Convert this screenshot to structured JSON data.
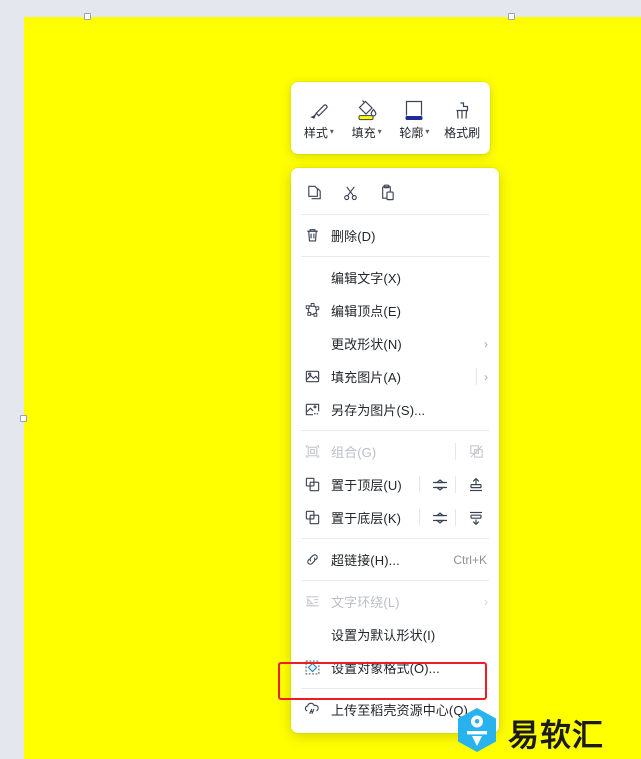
{
  "canvas": {
    "shape_fill_color": "#ffff00",
    "background_color": "#e4e7ee",
    "shape_name": "selected-yellow-rectangle"
  },
  "format_toolbar": {
    "items": [
      {
        "label": "样式",
        "icon": "brush-icon",
        "has_caret": true
      },
      {
        "label": "填充",
        "icon": "paint-bucket-icon",
        "has_caret": true,
        "color_bar": "#ffff00"
      },
      {
        "label": "轮廓",
        "icon": "shape-outline-icon",
        "has_caret": true,
        "color_bar": "#1f2c96"
      },
      {
        "label": "格式刷",
        "icon": "format-painter-icon",
        "has_caret": false
      }
    ],
    "caret_glyph": "▾"
  },
  "context_menu": {
    "clipboard": [
      {
        "label": "复制",
        "icon": "copy-icon"
      },
      {
        "label": "剪切",
        "icon": "cut-scissors-icon"
      },
      {
        "label": "粘贴",
        "icon": "paste-icon"
      }
    ],
    "items": [
      {
        "label": "删除(D)",
        "icon": "trash-icon",
        "disabled": false,
        "indent": false
      },
      {
        "label": "编辑文字(X)",
        "icon": "",
        "disabled": false,
        "indent": true
      },
      {
        "label": "编辑顶点(E)",
        "icon": "edit-points-icon",
        "disabled": false,
        "indent": false
      },
      {
        "label": "更改形状(N)",
        "icon": "",
        "disabled": false,
        "indent": true,
        "arrow": "›"
      },
      {
        "label": "填充图片(A)",
        "icon": "fill-picture-icon",
        "disabled": false,
        "indent": false,
        "arrow": "›",
        "divider": true
      },
      {
        "label": "另存为图片(S)...",
        "icon": "save-as-picture-icon",
        "disabled": false,
        "indent": false
      },
      {
        "label": "组合(G)",
        "icon": "group-icon",
        "disabled": true,
        "indent": false,
        "divider": true,
        "extra_icon": "ungroup-icon"
      },
      {
        "label": "置于顶层(U)",
        "icon": "bring-to-front-icon",
        "disabled": false,
        "indent": false,
        "divider": true,
        "extra_icon": "bring-forward-icon",
        "mid_icon": "align-middle-icon"
      },
      {
        "label": "置于底层(K)",
        "icon": "send-to-back-icon",
        "disabled": false,
        "indent": false,
        "divider": true,
        "extra_icon": "send-backward-icon",
        "mid_icon": "align-middle-icon"
      },
      {
        "label": "超链接(H)...",
        "icon": "hyperlink-icon",
        "disabled": false,
        "indent": false,
        "shortcut": "Ctrl+K"
      },
      {
        "label": "文字环绕(L)",
        "icon": "text-wrap-icon",
        "disabled": true,
        "indent": false,
        "arrow": "›"
      },
      {
        "label": "设置为默认形状(I)",
        "icon": "",
        "disabled": false,
        "indent": true
      },
      {
        "label": "设置对象格式(O)...",
        "icon": "format-object-icon",
        "disabled": false,
        "indent": false,
        "highlighted": true
      },
      {
        "label": "上传至稻壳资源中心(Q)",
        "icon": "upload-cloud-icon",
        "disabled": false,
        "indent": false
      }
    ]
  },
  "highlight": {
    "color": "#ee1c25",
    "target_label": "设置对象格式(O)..."
  },
  "watermark": {
    "text": "易软汇",
    "logo_color": "#29b3ee",
    "logo_name": "yiruanhui-hex-logo"
  }
}
